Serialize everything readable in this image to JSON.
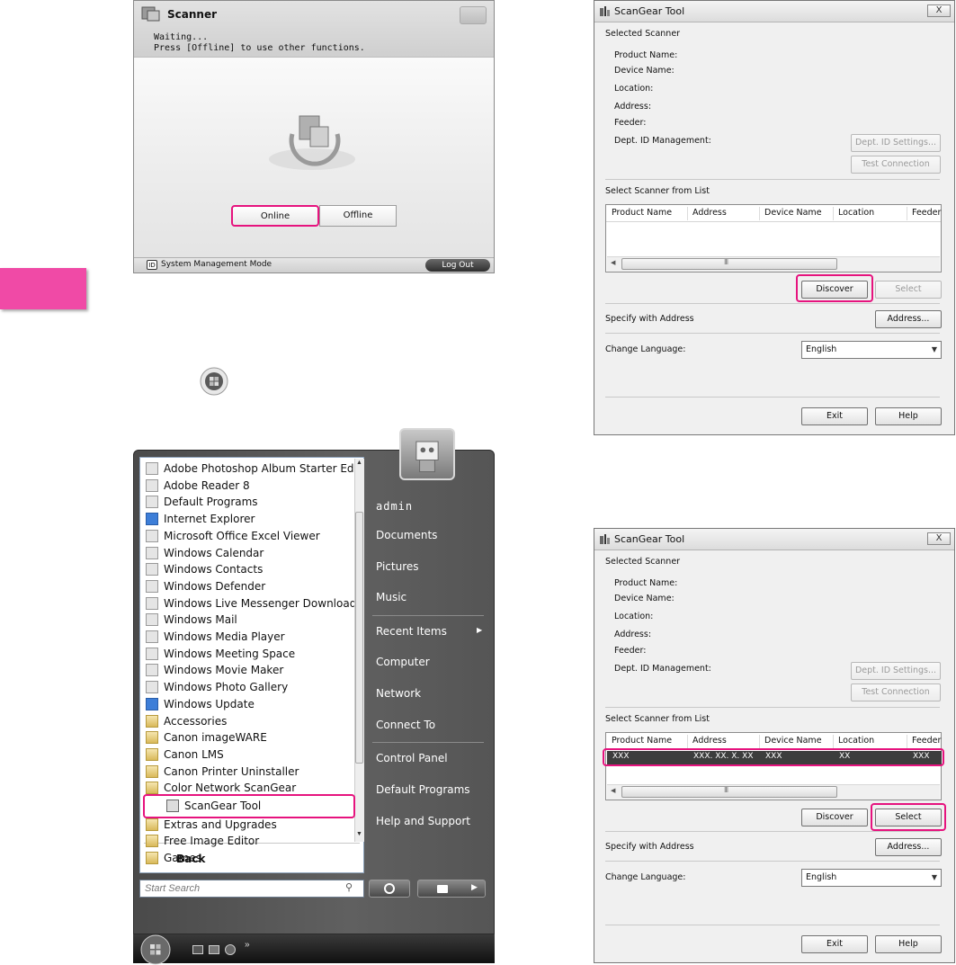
{
  "scanner_panel": {
    "title": "Scanner",
    "status_line1": "Waiting...",
    "status_line2": "Press [Offline] to use other functions.",
    "online_label": "Online",
    "offline_label": "Offline",
    "mode_label": "System Management Mode",
    "mode_badge": "ID",
    "logout_label": "Log Out"
  },
  "start_menu": {
    "programs": [
      {
        "label": "Adobe Photoshop Album Starter Edition",
        "icon": "app-icon"
      },
      {
        "label": "Adobe Reader 8",
        "icon": "pdf-icon"
      },
      {
        "label": "Default Programs",
        "icon": "default-programs-icon"
      },
      {
        "label": "Internet Explorer",
        "icon": "ie-icon"
      },
      {
        "label": "Microsoft Office Excel Viewer",
        "icon": "excel-icon"
      },
      {
        "label": "Windows Calendar",
        "icon": "calendar-icon"
      },
      {
        "label": "Windows Contacts",
        "icon": "contacts-icon"
      },
      {
        "label": "Windows Defender",
        "icon": "defender-icon"
      },
      {
        "label": "Windows Live Messenger Download",
        "icon": "messenger-icon"
      },
      {
        "label": "Windows Mail",
        "icon": "mail-icon"
      },
      {
        "label": "Windows Media Player",
        "icon": "media-player-icon"
      },
      {
        "label": "Windows Meeting Space",
        "icon": "meeting-icon"
      },
      {
        "label": "Windows Movie Maker",
        "icon": "movie-icon"
      },
      {
        "label": "Windows Photo Gallery",
        "icon": "photo-icon"
      },
      {
        "label": "Windows Update",
        "icon": "update-icon"
      },
      {
        "label": "Accessories",
        "icon": "folder-icon"
      },
      {
        "label": "Canon imageWARE",
        "icon": "folder-icon"
      },
      {
        "label": "Canon LMS",
        "icon": "folder-icon"
      },
      {
        "label": "Canon Printer Uninstaller",
        "icon": "folder-icon"
      },
      {
        "label": "Color Network ScanGear",
        "icon": "folder-icon"
      }
    ],
    "selected_program": "ScanGear Tool",
    "programs_after": [
      {
        "label": "Extras and Upgrades",
        "icon": "folder-icon"
      },
      {
        "label": "Free Image Editor",
        "icon": "folder-icon"
      },
      {
        "label": "Games",
        "icon": "folder-icon"
      }
    ],
    "back_label": "Back",
    "search_placeholder": "Start Search",
    "right_items": [
      "admin",
      "Documents",
      "Pictures",
      "Music",
      "Recent Items",
      "Computer",
      "Network",
      "Connect To",
      "Control Panel",
      "Default Programs",
      "Help and Support"
    ]
  },
  "scangear_top": {
    "title": "ScanGear Tool",
    "close_label": "X",
    "selected_scanner_label": "Selected Scanner",
    "fields": [
      "Product Name:",
      "Device Name:",
      "Location:",
      "Address:",
      "Feeder:",
      "Dept. ID Management:"
    ],
    "dept_settings_label": "Dept. ID Settings...",
    "test_connection_label": "Test Connection",
    "select_from_list_label": "Select Scanner from List",
    "columns": [
      "Product Name",
      "Address",
      "Device Name",
      "Location",
      "Feeder"
    ],
    "scroll_grip": "III",
    "discover_label": "Discover",
    "select_label": "Select",
    "specify_address_label": "Specify with Address",
    "address_button_label": "Address...",
    "change_language_label": "Change Language:",
    "language_value": "English",
    "exit_label": "Exit",
    "help_label": "Help"
  },
  "scangear_bottom": {
    "title": "ScanGear Tool",
    "close_label": "X",
    "selected_scanner_label": "Selected Scanner",
    "fields": [
      "Product Name:",
      "Device Name:",
      "Location:",
      "Address:",
      "Feeder:",
      "Dept. ID Management:"
    ],
    "dept_settings_label": "Dept. ID Settings...",
    "test_connection_label": "Test Connection",
    "select_from_list_label": "Select Scanner from List",
    "columns": [
      "Product Name",
      "Address",
      "Device Name",
      "Location",
      "Feeder"
    ],
    "row": [
      "XXX",
      "XXX. XX. X. XX",
      "XXX",
      "XX",
      "XXX"
    ],
    "scroll_grip": "III",
    "discover_label": "Discover",
    "select_label": "Select",
    "specify_address_label": "Specify with Address",
    "address_button_label": "Address...",
    "change_language_label": "Change Language:",
    "language_value": "English",
    "exit_label": "Exit",
    "help_label": "Help"
  },
  "colors": {
    "highlight": "#e6137e",
    "pink_tab": "#f04aa6"
  }
}
